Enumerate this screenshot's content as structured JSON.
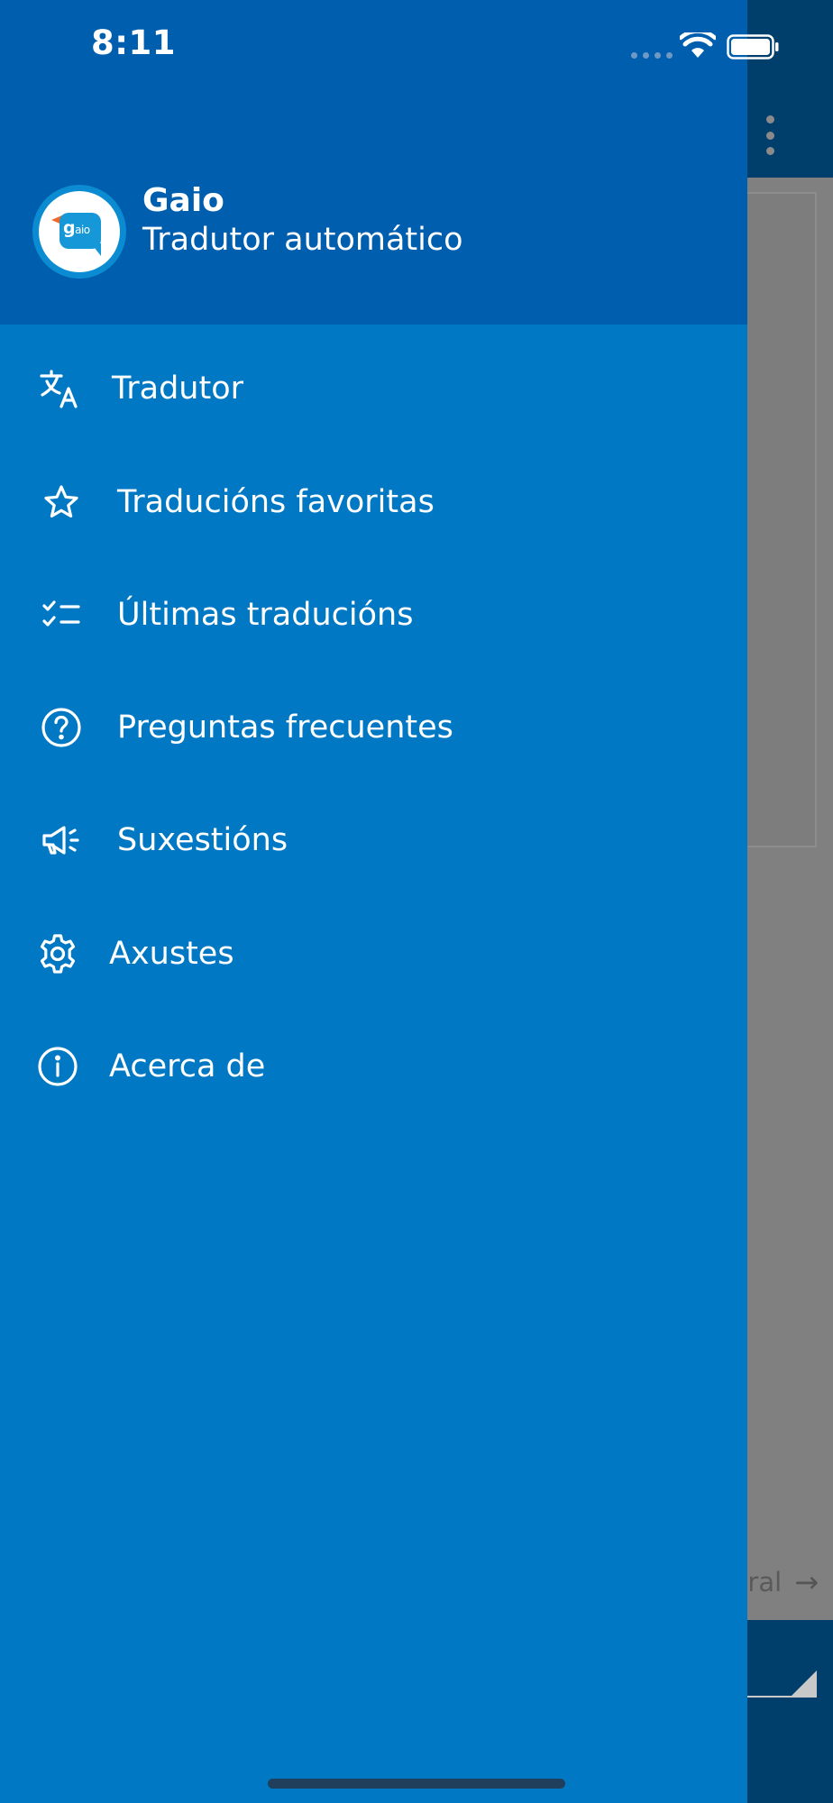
{
  "status_bar": {
    "time": "8:11"
  },
  "app": {
    "name": "Gaio",
    "subtitle": "Tradutor automático",
    "logo_text": "g",
    "logo_text_small": "aio"
  },
  "menu": {
    "items": [
      {
        "label": "Tradutor",
        "icon": "translate-icon"
      },
      {
        "label": "Traducións favoritas",
        "icon": "star-icon"
      },
      {
        "label": "Últimas traducións",
        "icon": "checklist-icon"
      },
      {
        "label": "Preguntas frecuentes",
        "icon": "help-circle-icon"
      },
      {
        "label": "Suxestións",
        "icon": "megaphone-icon"
      },
      {
        "label": "Axustes",
        "icon": "gear-icon"
      },
      {
        "label": "Acerca de",
        "icon": "info-icon"
      }
    ]
  },
  "background": {
    "partial_text": "ral"
  },
  "colors": {
    "drawer": "#0078c4",
    "drawer_header": "#005eaf",
    "background_appbar": "#003f6b",
    "scrim": "#808080"
  }
}
